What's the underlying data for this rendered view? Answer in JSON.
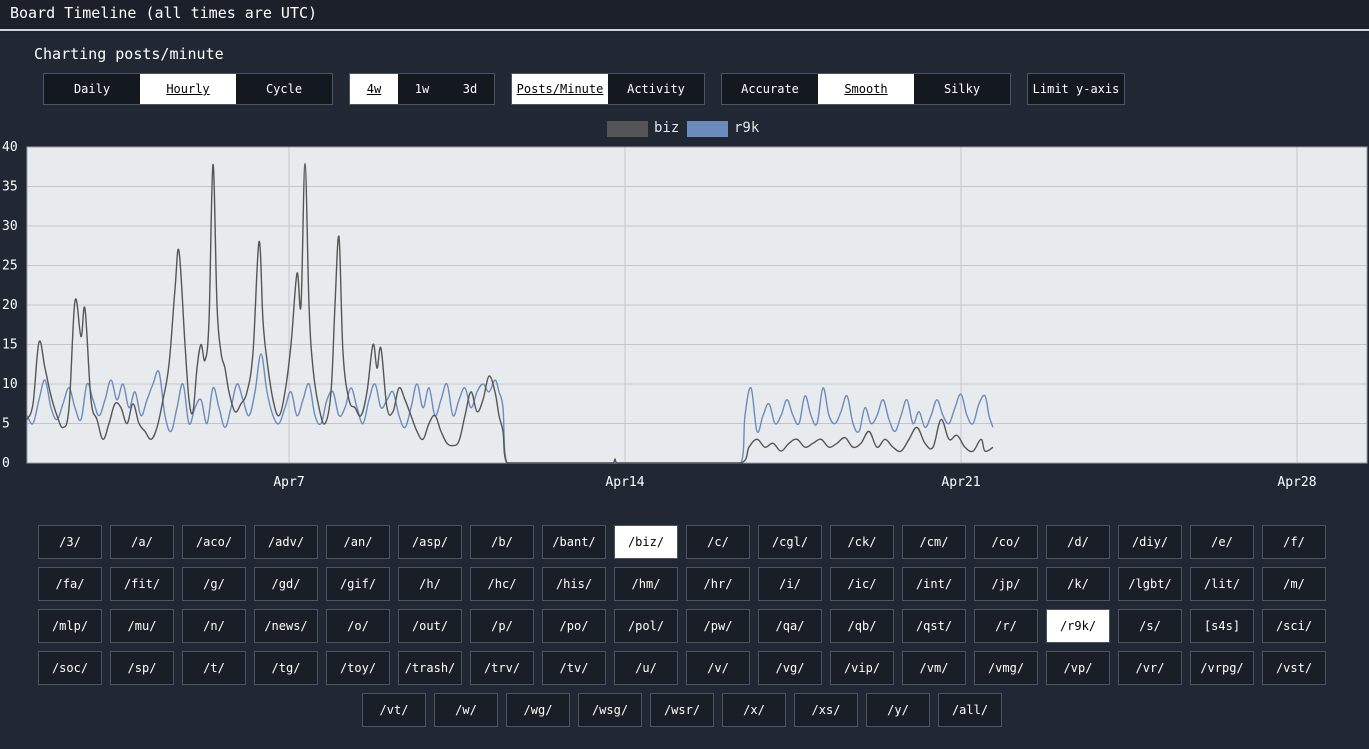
{
  "header": {
    "title": "Board Timeline (all times are UTC)"
  },
  "subtitle": "Charting posts/minute",
  "controls": {
    "period": {
      "options": [
        "Daily",
        "Hourly",
        "Cycle"
      ],
      "selected": "Hourly"
    },
    "range": {
      "options": [
        "4w",
        "1w",
        "3d"
      ],
      "selected": "4w"
    },
    "metric": {
      "options": [
        "Posts/Minute",
        "Activity"
      ],
      "selected": "Posts/Minute"
    },
    "smoothing": {
      "options": [
        "Accurate",
        "Smooth",
        "Silky"
      ],
      "selected": "Smooth"
    },
    "limit_y_label": "Limit y-axis"
  },
  "colors": {
    "biz": "#555555",
    "r9k": "#6a8cbd",
    "plot_bg": "#e8ebee",
    "page_bg": "#212833"
  },
  "chart_data": {
    "type": "line",
    "x_unit": "days",
    "xlim": [
      "Apr 1 13:00",
      "Apr 29 11:00"
    ],
    "ylim": [
      0,
      40
    ],
    "yticks": [
      0,
      5,
      10,
      15,
      20,
      25,
      30,
      35,
      40
    ],
    "xticks": [
      {
        "label": "Apr7",
        "value": "Apr 7 00:00"
      },
      {
        "label": "Apr14",
        "value": "Apr 14 00:00"
      },
      {
        "label": "Apr21",
        "value": "Apr 21 00:00"
      },
      {
        "label": "Apr28",
        "value": "Apr 28 00:00"
      }
    ],
    "legend_position": "top-center",
    "grid": true,
    "series": [
      {
        "name": "biz",
        "color": "#555555",
        "points": [
          [
            "Apr 1 13:00",
            5.5
          ],
          [
            "Apr 1 16:00",
            7.5
          ],
          [
            "Apr 1 19:00",
            15.3
          ],
          [
            "Apr 1 22:00",
            12
          ],
          [
            "Apr 2 01:00",
            8.5
          ],
          [
            "Apr 2 04:00",
            6
          ],
          [
            "Apr 2 07:00",
            4.5
          ],
          [
            "Apr 2 10:00",
            7
          ],
          [
            "Apr 2 13:00",
            20.5
          ],
          [
            "Apr 2 16:00",
            16
          ],
          [
            "Apr 2 18:00",
            19.5
          ],
          [
            "Apr 2 21:00",
            8
          ],
          [
            "Apr 3 00:00",
            5.5
          ],
          [
            "Apr 3 03:00",
            3
          ],
          [
            "Apr 3 06:00",
            5
          ],
          [
            "Apr 3 09:00",
            7.5
          ],
          [
            "Apr 3 12:00",
            7
          ],
          [
            "Apr 3 15:00",
            5
          ],
          [
            "Apr 3 18:00",
            7.5
          ],
          [
            "Apr 3 21:00",
            5
          ],
          [
            "Apr 4 00:00",
            4
          ],
          [
            "Apr 4 03:00",
            3
          ],
          [
            "Apr 4 06:00",
            4.5
          ],
          [
            "Apr 4 09:00",
            8
          ],
          [
            "Apr 4 12:00",
            12.5
          ],
          [
            "Apr 4 15:00",
            22
          ],
          [
            "Apr 4 17:00",
            26.8
          ],
          [
            "Apr 4 20:00",
            15
          ],
          [
            "Apr 4 22:00",
            8
          ],
          [
            "Apr 5 00:00",
            6.5
          ],
          [
            "Apr 5 02:00",
            12
          ],
          [
            "Apr 5 04:00",
            15
          ],
          [
            "Apr 5 06:00",
            13
          ],
          [
            "Apr 5 08:00",
            18
          ],
          [
            "Apr 5 10:00",
            37.8
          ],
          [
            "Apr 5 12:00",
            20
          ],
          [
            "Apr 5 14:00",
            14
          ],
          [
            "Apr 5 16:00",
            12
          ],
          [
            "Apr 5 18:00",
            9
          ],
          [
            "Apr 5 21:00",
            6.5
          ],
          [
            "Apr 6 00:00",
            7.5
          ],
          [
            "Apr 6 03:00",
            9
          ],
          [
            "Apr 6 06:00",
            14
          ],
          [
            "Apr 6 09:00",
            28
          ],
          [
            "Apr 6 11:00",
            18
          ],
          [
            "Apr 6 13:00",
            13
          ],
          [
            "Apr 6 16:00",
            8
          ],
          [
            "Apr 6 19:00",
            6
          ],
          [
            "Apr 6 22:00",
            9
          ],
          [
            "Apr 7 01:00",
            15
          ],
          [
            "Apr 7 04:00",
            24
          ],
          [
            "Apr 7 06:00",
            20
          ],
          [
            "Apr 7 08:00",
            37.9
          ],
          [
            "Apr 7 10:00",
            20
          ],
          [
            "Apr 7 12:00",
            12
          ],
          [
            "Apr 7 15:00",
            7
          ],
          [
            "Apr 7 18:00",
            5
          ],
          [
            "Apr 7 21:00",
            9
          ],
          [
            "Apr 7 23:00",
            20
          ],
          [
            "Apr 8 01:00",
            28.6
          ],
          [
            "Apr 8 03:00",
            14
          ],
          [
            "Apr 8 06:00",
            8
          ],
          [
            "Apr 8 09:00",
            7
          ],
          [
            "Apr 8 12:00",
            6
          ],
          [
            "Apr 8 15:00",
            9
          ],
          [
            "Apr 8 18:00",
            15
          ],
          [
            "Apr 8 20:00",
            12
          ],
          [
            "Apr 8 22:00",
            14.5
          ],
          [
            "Apr 9 01:00",
            7
          ],
          [
            "Apr 9 04:00",
            6.5
          ],
          [
            "Apr 9 07:00",
            9.5
          ],
          [
            "Apr 9 10:00",
            8
          ],
          [
            "Apr 9 13:00",
            6
          ],
          [
            "Apr 9 16:00",
            4
          ],
          [
            "Apr 9 19:00",
            3
          ],
          [
            "Apr 9 22:00",
            5
          ],
          [
            "Apr 10 01:00",
            6
          ],
          [
            "Apr 10 04:00",
            4
          ],
          [
            "Apr 10 07:00",
            2.5
          ],
          [
            "Apr 10 10:00",
            2.2
          ],
          [
            "Apr 10 13:00",
            2.8
          ],
          [
            "Apr 10 16:00",
            6
          ],
          [
            "Apr 10 19:00",
            9
          ],
          [
            "Apr 10 22:00",
            6.5
          ],
          [
            "Apr 11 01:00",
            8
          ],
          [
            "Apr 11 04:00",
            11
          ],
          [
            "Apr 11 07:00",
            9
          ],
          [
            "Apr 11 09:00",
            6
          ],
          [
            "Apr 11 11:00",
            4
          ],
          [
            "Apr 11 13:00",
            0
          ],
          [
            "Apr 13 18:00",
            0
          ],
          [
            "Apr 13 19:00",
            0.5
          ],
          [
            "Apr 13 20:00",
            0
          ],
          [
            "Apr 16 10:00",
            0
          ],
          [
            "Apr 16 14:00",
            2
          ],
          [
            "Apr 16 18:00",
            3
          ],
          [
            "Apr 16 22:00",
            2
          ],
          [
            "Apr 17 02:00",
            2.5
          ],
          [
            "Apr 17 06:00",
            1.5
          ],
          [
            "Apr 17 10:00",
            2.5
          ],
          [
            "Apr 17 14:00",
            3
          ],
          [
            "Apr 17 18:00",
            2
          ],
          [
            "Apr 17 22:00",
            2.5
          ],
          [
            "Apr 18 02:00",
            3
          ],
          [
            "Apr 18 06:00",
            2
          ],
          [
            "Apr 18 10:00",
            2.5
          ],
          [
            "Apr 18 14:00",
            3.2
          ],
          [
            "Apr 18 18:00",
            2
          ],
          [
            "Apr 18 22:00",
            2.5
          ],
          [
            "Apr 19 02:00",
            4
          ],
          [
            "Apr 19 06:00",
            2
          ],
          [
            "Apr 19 10:00",
            3
          ],
          [
            "Apr 19 14:00",
            2
          ],
          [
            "Apr 19 18:00",
            1.5
          ],
          [
            "Apr 19 22:00",
            3
          ],
          [
            "Apr 20 02:00",
            4.5
          ],
          [
            "Apr 20 06:00",
            2.5
          ],
          [
            "Apr 20 10:00",
            2
          ],
          [
            "Apr 20 14:00",
            5.5
          ],
          [
            "Apr 20 18:00",
            3
          ],
          [
            "Apr 20 22:00",
            3.5
          ],
          [
            "Apr 21 02:00",
            2
          ],
          [
            "Apr 21 06:00",
            1.5
          ],
          [
            "Apr 21 10:00",
            3
          ],
          [
            "Apr 21 12:00",
            1.5
          ],
          [
            "Apr 21 16:00",
            2
          ]
        ]
      },
      {
        "name": "r9k",
        "color": "#6a8cbd",
        "points": [
          [
            "Apr 1 13:00",
            6
          ],
          [
            "Apr 1 16:00",
            5
          ],
          [
            "Apr 1 19:00",
            8
          ],
          [
            "Apr 1 22:00",
            10.5
          ],
          [
            "Apr 2 01:00",
            7
          ],
          [
            "Apr 2 04:00",
            5.5
          ],
          [
            "Apr 2 07:00",
            7.5
          ],
          [
            "Apr 2 10:00",
            9.5
          ],
          [
            "Apr 2 13:00",
            7
          ],
          [
            "Apr 2 16:00",
            5.5
          ],
          [
            "Apr 2 19:00",
            10
          ],
          [
            "Apr 2 22:00",
            8
          ],
          [
            "Apr 3 01:00",
            6
          ],
          [
            "Apr 3 04:00",
            8
          ],
          [
            "Apr 3 07:00",
            10.5
          ],
          [
            "Apr 3 10:00",
            8
          ],
          [
            "Apr 3 13:00",
            10
          ],
          [
            "Apr 3 16:00",
            7
          ],
          [
            "Apr 3 19:00",
            9
          ],
          [
            "Apr 3 22:00",
            6
          ],
          [
            "Apr 4 01:00",
            8
          ],
          [
            "Apr 4 04:00",
            10
          ],
          [
            "Apr 4 07:00",
            11.5
          ],
          [
            "Apr 4 10:00",
            6
          ],
          [
            "Apr 4 13:00",
            4
          ],
          [
            "Apr 4 16:00",
            7
          ],
          [
            "Apr 4 19:00",
            10
          ],
          [
            "Apr 4 22:00",
            5
          ],
          [
            "Apr 5 01:00",
            7
          ],
          [
            "Apr 5 04:00",
            8
          ],
          [
            "Apr 5 07:00",
            5
          ],
          [
            "Apr 5 10:00",
            9.5
          ],
          [
            "Apr 5 13:00",
            7
          ],
          [
            "Apr 5 16:00",
            4.5
          ],
          [
            "Apr 5 19:00",
            7
          ],
          [
            "Apr 5 22:00",
            10
          ],
          [
            "Apr 6 01:00",
            8
          ],
          [
            "Apr 6 04:00",
            6
          ],
          [
            "Apr 6 07:00",
            9
          ],
          [
            "Apr 6 10:00",
            13.8
          ],
          [
            "Apr 6 13:00",
            9
          ],
          [
            "Apr 6 16:00",
            6
          ],
          [
            "Apr 6 19:00",
            5
          ],
          [
            "Apr 6 22:00",
            7
          ],
          [
            "Apr 7 01:00",
            9
          ],
          [
            "Apr 7 04:00",
            6
          ],
          [
            "Apr 7 07:00",
            8
          ],
          [
            "Apr 7 10:00",
            10
          ],
          [
            "Apr 7 13:00",
            6
          ],
          [
            "Apr 7 16:00",
            5
          ],
          [
            "Apr 7 19:00",
            8
          ],
          [
            "Apr 7 22:00",
            9
          ],
          [
            "Apr 8 01:00",
            6
          ],
          [
            "Apr 8 04:00",
            7
          ],
          [
            "Apr 8 07:00",
            9.5
          ],
          [
            "Apr 8 10:00",
            7
          ],
          [
            "Apr 8 13:00",
            5
          ],
          [
            "Apr 8 16:00",
            8
          ],
          [
            "Apr 8 19:00",
            10
          ],
          [
            "Apr 8 22:00",
            7
          ],
          [
            "Apr 9 01:00",
            8
          ],
          [
            "Apr 9 04:00",
            9
          ],
          [
            "Apr 9 07:00",
            6
          ],
          [
            "Apr 9 10:00",
            4.5
          ],
          [
            "Apr 9 13:00",
            7
          ],
          [
            "Apr 9 16:00",
            10
          ],
          [
            "Apr 9 19:00",
            7
          ],
          [
            "Apr 9 22:00",
            9.5
          ],
          [
            "Apr 10 01:00",
            6
          ],
          [
            "Apr 10 04:00",
            8
          ],
          [
            "Apr 10 07:00",
            10
          ],
          [
            "Apr 10 10:00",
            6
          ],
          [
            "Apr 10 13:00",
            8
          ],
          [
            "Apr 10 16:00",
            9.5
          ],
          [
            "Apr 10 19:00",
            7
          ],
          [
            "Apr 10 22:00",
            9
          ],
          [
            "Apr 11 01:00",
            10
          ],
          [
            "Apr 11 04:00",
            9
          ],
          [
            "Apr 11 07:00",
            10.5
          ],
          [
            "Apr 11 09:00",
            9
          ],
          [
            "Apr 11 11:00",
            7
          ],
          [
            "Apr 11 13:00",
            0
          ],
          [
            "Apr 16 10:00",
            0
          ],
          [
            "Apr 16 12:00",
            6
          ],
          [
            "Apr 16 15:00",
            9.5
          ],
          [
            "Apr 16 18:00",
            4
          ],
          [
            "Apr 16 21:00",
            6
          ],
          [
            "Apr 17 00:00",
            7.5
          ],
          [
            "Apr 17 03:00",
            5
          ],
          [
            "Apr 17 06:00",
            6
          ],
          [
            "Apr 17 09:00",
            8
          ],
          [
            "Apr 17 12:00",
            6
          ],
          [
            "Apr 17 15:00",
            5
          ],
          [
            "Apr 17 18:00",
            8.5
          ],
          [
            "Apr 17 21:00",
            6
          ],
          [
            "Apr 18 00:00",
            5
          ],
          [
            "Apr 18 03:00",
            9.5
          ],
          [
            "Apr 18 06:00",
            6
          ],
          [
            "Apr 18 09:00",
            5
          ],
          [
            "Apr 18 12:00",
            6.5
          ],
          [
            "Apr 18 15:00",
            8.5
          ],
          [
            "Apr 18 18:00",
            5
          ],
          [
            "Apr 18 21:00",
            4
          ],
          [
            "Apr 19 00:00",
            7
          ],
          [
            "Apr 19 03:00",
            5
          ],
          [
            "Apr 19 06:00",
            6
          ],
          [
            "Apr 19 09:00",
            8
          ],
          [
            "Apr 19 12:00",
            5.5
          ],
          [
            "Apr 19 15:00",
            4
          ],
          [
            "Apr 19 18:00",
            6
          ],
          [
            "Apr 19 21:00",
            8
          ],
          [
            "Apr 20 00:00",
            5
          ],
          [
            "Apr 20 03:00",
            6.5
          ],
          [
            "Apr 20 06:00",
            4.5
          ],
          [
            "Apr 20 09:00",
            6
          ],
          [
            "Apr 20 12:00",
            8
          ],
          [
            "Apr 20 15:00",
            6
          ],
          [
            "Apr 20 18:00",
            5
          ],
          [
            "Apr 20 21:00",
            7
          ],
          [
            "Apr 21 00:00",
            8.7
          ],
          [
            "Apr 21 03:00",
            6
          ],
          [
            "Apr 21 06:00",
            5
          ],
          [
            "Apr 21 09:00",
            7.5
          ],
          [
            "Apr 21 12:00",
            8.5
          ],
          [
            "Apr 21 14:00",
            6
          ],
          [
            "Apr 21 16:00",
            4.5
          ]
        ]
      }
    ]
  },
  "boards": [
    [
      "/3/",
      "/a/",
      "/aco/",
      "/adv/",
      "/an/",
      "/asp/",
      "/b/",
      "/bant/",
      "/biz/",
      "/c/",
      "/cgl/",
      "/ck/",
      "/cm/",
      "/co/",
      "/d/",
      "/diy/",
      "/e/",
      "/f/"
    ],
    [
      "/fa/",
      "/fit/",
      "/g/",
      "/gd/",
      "/gif/",
      "/h/",
      "/hc/",
      "/his/",
      "/hm/",
      "/hr/",
      "/i/",
      "/ic/",
      "/int/",
      "/jp/",
      "/k/",
      "/lgbt/",
      "/lit/",
      "/m/"
    ],
    [
      "/mlp/",
      "/mu/",
      "/n/",
      "/news/",
      "/o/",
      "/out/",
      "/p/",
      "/po/",
      "/pol/",
      "/pw/",
      "/qa/",
      "/qb/",
      "/qst/",
      "/r/",
      "/r9k/",
      "/s/",
      "[s4s]",
      "/sci/"
    ],
    [
      "/soc/",
      "/sp/",
      "/t/",
      "/tg/",
      "/toy/",
      "/trash/",
      "/trv/",
      "/tv/",
      "/u/",
      "/v/",
      "/vg/",
      "/vip/",
      "/vm/",
      "/vmg/",
      "/vp/",
      "/vr/",
      "/vrpg/",
      "/vst/"
    ],
    [
      "/vt/",
      "/w/",
      "/wg/",
      "/wsg/",
      "/wsr/",
      "/x/",
      "/xs/",
      "/y/",
      "/all/"
    ]
  ],
  "selected_boards": [
    "/biz/",
    "/r9k/"
  ]
}
